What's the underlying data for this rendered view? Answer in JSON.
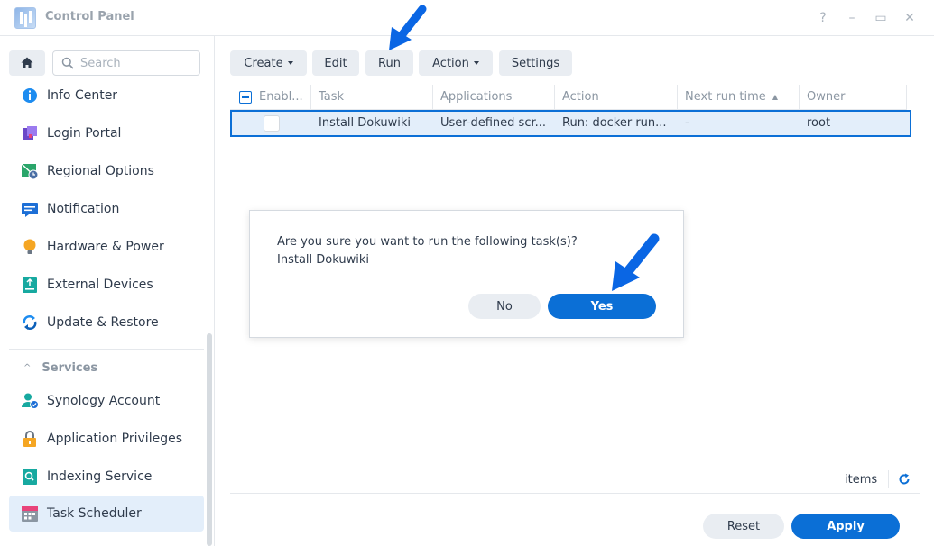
{
  "window": {
    "title": "Control Panel",
    "help_label": "?",
    "minimize_label": "–",
    "maximize_label": "▭",
    "close_label": "✕"
  },
  "sidebar": {
    "search_placeholder": "Search",
    "items": [
      {
        "label": "Info Center",
        "icon": "info-icon"
      },
      {
        "label": "Login Portal",
        "icon": "login-portal-icon"
      },
      {
        "label": "Regional Options",
        "icon": "regional-options-icon"
      },
      {
        "label": "Notification",
        "icon": "notification-icon"
      },
      {
        "label": "Hardware & Power",
        "icon": "lightbulb-icon"
      },
      {
        "label": "External Devices",
        "icon": "external-device-icon"
      },
      {
        "label": "Update & Restore",
        "icon": "update-icon"
      }
    ],
    "section": {
      "label": "Services",
      "chevron": "^"
    },
    "service_items": [
      {
        "label": "Synology Account",
        "icon": "account-icon"
      },
      {
        "label": "Application Privileges",
        "icon": "lock-icon"
      },
      {
        "label": "Indexing Service",
        "icon": "indexing-icon"
      },
      {
        "label": "Task Scheduler",
        "icon": "calendar-icon",
        "active": true
      }
    ]
  },
  "toolbar": {
    "create_label": "Create",
    "edit_label": "Edit",
    "run_label": "Run",
    "action_label": "Action",
    "settings_label": "Settings"
  },
  "grid": {
    "columns": [
      "Enabl...",
      "Task",
      "Applications",
      "Action",
      "Next run time",
      "Owner"
    ],
    "sort_indicator": "▲",
    "rows": [
      {
        "task": "Install Dokuwiki",
        "applications": "User-defined scr...",
        "action": "Run: docker run...",
        "next_run": "-",
        "owner": "root"
      }
    ]
  },
  "footer": {
    "items_label": "items",
    "reset_label": "Reset",
    "apply_label": "Apply"
  },
  "dialog": {
    "message_line1": "Are you sure you want to run the following task(s)?",
    "message_line2": "Install Dokuwiki",
    "no_label": "No",
    "yes_label": "Yes"
  },
  "colors": {
    "accent": "#0b6fd6",
    "selection": "#e3eefa",
    "arrow": "#0a66e4"
  }
}
